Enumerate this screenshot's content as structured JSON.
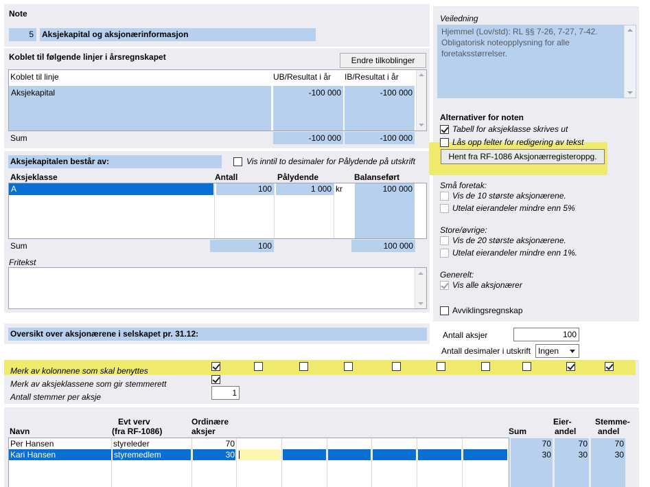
{
  "note": {
    "title": "Note",
    "number": "5",
    "name": "Aksjekapital og aksjonærinformasjon"
  },
  "linked": {
    "title": "Koblet til følgende linjer i årsregnskapet",
    "change_button": "Endre tilkoblinger",
    "col_line": "Koblet til linje",
    "col_ub": "UB/Resultat i år",
    "col_ib": "IB/Resultat i år",
    "rows": [
      {
        "line": "Aksjekapital",
        "ub": "-100 000",
        "ib": "-100 000"
      }
    ],
    "sum_label": "Sum",
    "sum_ub": "-100 000",
    "sum_ib": "-100 000"
  },
  "share_capital": {
    "title": "Aksjekapitalen består av:",
    "decimals_checkbox": "Vis inntil to desimaler for Pålydende på utskrift",
    "col_class": "Aksjeklasse",
    "col_count": "Antall",
    "col_par": "Pålydende",
    "col_balance": "Balanseført",
    "rows": [
      {
        "class": "A",
        "count": "100",
        "par": "1 000",
        "currency": "kr",
        "balance": "100 000"
      }
    ],
    "sum_label": "Sum",
    "sum_count": "100",
    "sum_balance": "100 000",
    "free_text_label": "Fritekst"
  },
  "guidance": {
    "title": "Veiledning",
    "text": "Hjemmel (Lov/std): RL §§ 7-26, 7-27, 7-42. Obligatorisk noteopplysning for alle foretaksstørrelser."
  },
  "options": {
    "title": "Alternativer for noten",
    "table_per_class": "Tabell for aksjeklasse skrives ut",
    "unlock_fields": "Lås opp felter for redigering av tekst",
    "fetch_button": "Hent fra RF-1086 Aksjonærregisteroppg.",
    "small_title": "Små foretak:",
    "small_top10": "Vis de 10 største aksjonærene.",
    "small_exclude": "Utelat eierandeler mindre enn 5%",
    "large_title": "Store/øvrige:",
    "large_top20": "Vis de 20 største aksjonærene.",
    "large_exclude": "Utelat eierandeler mindre enn 1%.",
    "general_title": "Generelt:",
    "general_all": "Vis alle aksjonærer",
    "liquidation": "Avviklingsregnskap"
  },
  "overview": {
    "title": "Oversikt over aksjonærene i selskapet pr. 31.12:",
    "shares_label": "Antall aksjer",
    "shares_value": "100",
    "decimals_label": "Antall desimaler i utskrift",
    "decimals_value": "Ingen",
    "mark_columns": "Merk av kolonnene som skal benyttes",
    "mark_classes": "Merk av aksjeklassene som gir stemmerett",
    "votes_per_share_label": "Antall stemmer per aksje",
    "votes_per_share_value": "1"
  },
  "shareholders": {
    "col_name": "Navn",
    "col_role_1": "Evt verv",
    "col_role_2": "(fra RF-1086)",
    "col_ord_1": "Ordinære",
    "col_ord_2": "aksjer",
    "col_sum": "Sum",
    "col_own_1": "Eier-",
    "col_own_2": "andel",
    "col_vote_1": "Stemme-",
    "col_vote_2": "andel",
    "rows": [
      {
        "name": "Per Hansen",
        "role": "styreleder",
        "ordinary": "70",
        "sum": "70",
        "ownership": "70",
        "votes": "70"
      },
      {
        "name": "Kari Hansen",
        "role": "styremedlem",
        "ordinary": "30",
        "sum": "30",
        "ownership": "30",
        "votes": "30"
      }
    ]
  },
  "colors": {
    "panel": "#ececf2",
    "field": "#b6d0ee",
    "selection": "#0a6fd2",
    "highlight": "#efe96d"
  }
}
